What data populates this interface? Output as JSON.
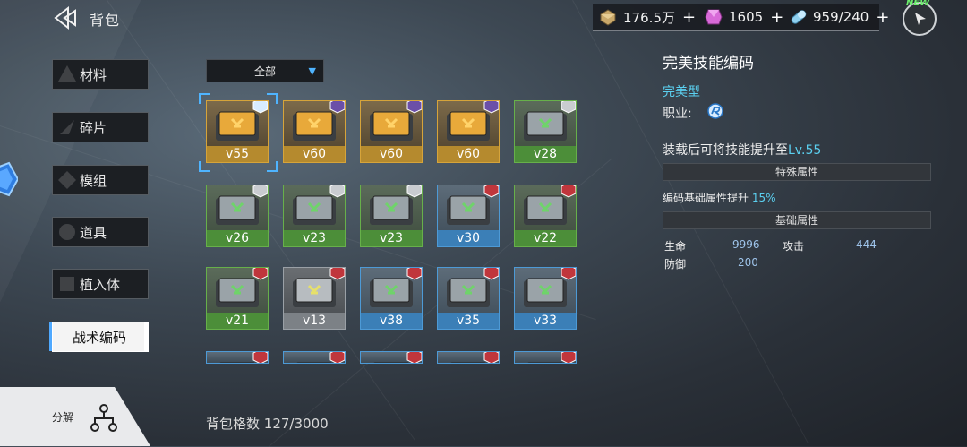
{
  "header": {
    "title": "背包"
  },
  "resources": [
    {
      "name": "gold-bar-icon",
      "value": "176.5万",
      "plus": "+"
    },
    {
      "name": "pink-crystal-icon",
      "value": "1605",
      "plus": "+"
    },
    {
      "name": "stamina-capsule-icon",
      "value": "959/240",
      "plus": "+"
    }
  ],
  "new_badge": "NEW",
  "sidebar": {
    "items": [
      {
        "label": "材料"
      },
      {
        "label": "碎片"
      },
      {
        "label": "模组"
      },
      {
        "label": "道具"
      },
      {
        "label": "植入体"
      },
      {
        "label": "战术编码"
      }
    ],
    "active_index": 5
  },
  "decompose": {
    "label": "分解"
  },
  "filter": {
    "label": "全部"
  },
  "inventory": {
    "rows": [
      [
        {
          "level": "v55",
          "rarity": "gold",
          "badge": "class-r",
          "selected": true
        },
        {
          "level": "v60",
          "rarity": "gold",
          "badge": "purple"
        },
        {
          "level": "v60",
          "rarity": "gold",
          "badge": "purple"
        },
        {
          "level": "v60",
          "rarity": "gold",
          "badge": "purple"
        },
        {
          "level": "v28",
          "rarity": "green",
          "badge": "silver"
        }
      ],
      [
        {
          "level": "v26",
          "rarity": "green",
          "badge": "silver"
        },
        {
          "level": "v23",
          "rarity": "green",
          "badge": "silver"
        },
        {
          "level": "v23",
          "rarity": "green",
          "badge": "silver"
        },
        {
          "level": "v30",
          "rarity": "blue",
          "badge": "red"
        },
        {
          "level": "v22",
          "rarity": "green",
          "badge": "red"
        }
      ],
      [
        {
          "level": "v21",
          "rarity": "green",
          "badge": "red"
        },
        {
          "level": "v13",
          "rarity": "gray",
          "badge": "red"
        },
        {
          "level": "v38",
          "rarity": "blue",
          "badge": "red"
        },
        {
          "level": "v35",
          "rarity": "blue",
          "badge": "red"
        },
        {
          "level": "v33",
          "rarity": "blue",
          "badge": "red"
        }
      ],
      [
        {
          "level": "",
          "rarity": "blue",
          "badge": "red"
        },
        {
          "level": "",
          "rarity": "blue",
          "badge": "red"
        },
        {
          "level": "",
          "rarity": "blue",
          "badge": "red"
        },
        {
          "level": "",
          "rarity": "blue",
          "badge": "red"
        },
        {
          "level": "",
          "rarity": "blue",
          "badge": "red"
        }
      ]
    ]
  },
  "bag_capacity": {
    "label": "背包格数",
    "value": "127/3000"
  },
  "detail": {
    "title": "完美技能编码",
    "type": "完美型",
    "job_label": "职业:",
    "desc_prefix": "装载后可将技能提升至",
    "desc_level": "Lv.55",
    "special_header": "特殊属性",
    "special_line_prefix": "编码基础属性提升",
    "special_line_value": "15%",
    "basic_header": "基础属性",
    "stats": [
      {
        "label": "生命",
        "value": "9996"
      },
      {
        "label": "攻击",
        "value": "444"
      },
      {
        "label": "防御",
        "value": "200"
      }
    ]
  },
  "colors": {
    "accent": "#4fb4ff",
    "highlight": "#5bd0f0",
    "gold": "#d6a43a",
    "green": "#67b04a",
    "blue": "#4d9ad6"
  }
}
